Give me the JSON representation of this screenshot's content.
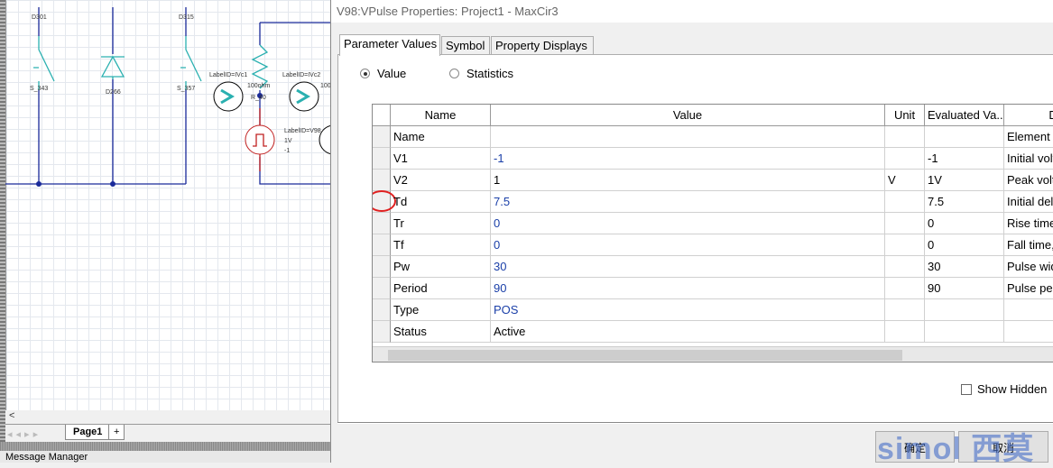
{
  "schematic": {
    "labels": [
      "D301",
      "D315",
      "S_343",
      "D266",
      "S_357",
      "LabelID=IVc1",
      "LabelID=IVc2",
      "100ohm",
      "100",
      "R_40",
      "LabelID=V98",
      "1V",
      "-1"
    ],
    "page_tab": "Page1",
    "add_tab": "+",
    "scroll_left": "<",
    "message_manager": "Message Manager"
  },
  "dialog": {
    "title": "V98:VPulse Properties: Project1 - MaxCir3",
    "tabs": [
      "Parameter Values",
      "Symbol",
      "Property Displays"
    ],
    "active_tab": "Parameter Values",
    "radios": [
      {
        "label": "Value",
        "selected": true
      },
      {
        "label": "Statistics",
        "selected": false
      }
    ],
    "columns": [
      "Name",
      "Value",
      "Unit",
      "Evaluated Va...",
      "Desc"
    ],
    "rows": [
      {
        "name": "Name",
        "value": "",
        "unit": "",
        "evaluated": "",
        "desc": "Element i"
      },
      {
        "name": "V1",
        "value": "-1",
        "unit": "",
        "evaluated": "-1",
        "desc": "Initial volt"
      },
      {
        "name": "V2",
        "value": "1",
        "unit": "V",
        "evaluated": "1V",
        "desc": "Peak volt"
      },
      {
        "name": "Td",
        "value": "7.5",
        "unit": "",
        "evaluated": "7.5",
        "desc": "Initial del"
      },
      {
        "name": "Tr",
        "value": "0",
        "unit": "",
        "evaluated": "0",
        "desc": "Rise time,"
      },
      {
        "name": "Tf",
        "value": "0",
        "unit": "",
        "evaluated": "0",
        "desc": "Fall time,"
      },
      {
        "name": "Pw",
        "value": "30",
        "unit": "",
        "evaluated": "30",
        "desc": "Pulse wid"
      },
      {
        "name": "Period",
        "value": "90",
        "unit": "",
        "evaluated": "90",
        "desc": "Pulse per"
      },
      {
        "name": "Type",
        "value": "POS",
        "unit": "",
        "evaluated": "",
        "desc": ""
      },
      {
        "name": "Status",
        "value": "Active",
        "unit": "",
        "evaluated": "",
        "desc": ""
      }
    ],
    "show_hidden": {
      "label": "Show Hidden",
      "checked": false
    },
    "ok_label": "确定",
    "cancel_label": "取消",
    "annotation_color": "#e02020"
  },
  "watermark": "simol 西莫"
}
